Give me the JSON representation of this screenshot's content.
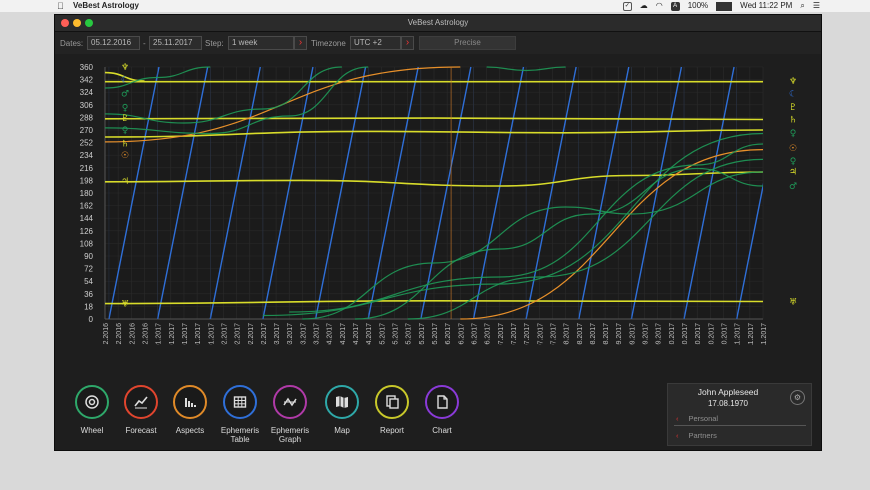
{
  "menubar": {
    "app_name": "VeBest Astrology",
    "battery": "100%",
    "clock": "Wed 11:22 PM"
  },
  "window": {
    "title": "VeBest Astrology",
    "traffic_colors": [
      "#ff5f57",
      "#febc2e",
      "#28c840"
    ]
  },
  "toolbar": {
    "dates_label": "Dates:",
    "date_from": "05.12.2016",
    "date_sep": "-",
    "date_to": "25.11.2017",
    "step_label": "Step:",
    "step_value": "1 week",
    "timezone_label": "Timezone",
    "timezone_value": "UTC +2",
    "precise_label": "Precise",
    "arrow_glyph": "›"
  },
  "chart_data": {
    "type": "line",
    "ylim": [
      0,
      360
    ],
    "y_ticks": [
      0,
      18,
      36,
      54,
      72,
      90,
      108,
      126,
      144,
      162,
      180,
      198,
      216,
      234,
      252,
      270,
      288,
      306,
      324,
      342,
      360
    ],
    "x_ticks": [
      "05.12.2016",
      "12.12.2016",
      "19.12.2016",
      "26.12.2016",
      "02.01.2017",
      "09.01.2017",
      "16.01.2017",
      "23.01.2017",
      "30.01.2017",
      "06.02.2017",
      "13.02.2017",
      "20.02.2017",
      "27.02.2017",
      "06.03.2017",
      "13.03.2017",
      "20.03.2017",
      "27.03.2017",
      "03.04.2017",
      "10.04.2017",
      "17.04.2017",
      "24.04.2017",
      "01.05.2017",
      "08.05.2017",
      "15.05.2017",
      "22.05.2017",
      "29.05.2017",
      "05.06.2017",
      "12.06.2017",
      "19.06.2017",
      "26.06.2017",
      "03.07.2017",
      "10.07.2017",
      "17.07.2017",
      "24.07.2017",
      "31.07.2017",
      "07.08.2017",
      "14.08.2017",
      "21.08.2017",
      "28.08.2017",
      "04.09.2017",
      "11.09.2017",
      "18.09.2017",
      "25.09.2017",
      "02.10.2017",
      "09.10.2017",
      "16.10.2017",
      "23.10.2017",
      "30.10.2017",
      "06.11.2017",
      "13.11.2017",
      "20.11.2017"
    ],
    "colors": {
      "moon": "#2f6fd8",
      "sun": "#e8902a",
      "yellow": "#d8dc2a",
      "green": "#1f9a58",
      "orange_line": "#c8782a"
    },
    "series": [
      {
        "kind": "yellow",
        "points": [
          [
            0,
            339
          ],
          [
            50,
            339
          ]
        ]
      },
      {
        "kind": "yellow",
        "points": [
          [
            0,
            286
          ],
          [
            25,
            287
          ],
          [
            50,
            285
          ]
        ]
      },
      {
        "kind": "yellow",
        "points": [
          [
            0,
            260
          ],
          [
            20,
            268
          ],
          [
            35,
            266
          ],
          [
            50,
            270
          ]
        ]
      },
      {
        "kind": "yellow",
        "points": [
          [
            0,
            196
          ],
          [
            15,
            198
          ],
          [
            30,
            190
          ],
          [
            40,
            205
          ],
          [
            50,
            210
          ]
        ]
      },
      {
        "kind": "yellow",
        "points": [
          [
            0,
            22
          ],
          [
            25,
            26
          ],
          [
            50,
            25
          ]
        ]
      },
      {
        "kind": "yellow",
        "points": [
          [
            0,
            352
          ],
          [
            3,
            340
          ]
        ]
      },
      {
        "kind": "sun",
        "points": [
          [
            0,
            253
          ],
          [
            27,
            360
          ]
        ]
      },
      {
        "kind": "sun",
        "points": [
          [
            27,
            0
          ],
          [
            50,
            242
          ]
        ]
      },
      {
        "kind": "green",
        "points": [
          [
            0,
            330
          ],
          [
            4,
            345
          ],
          [
            8,
            360
          ]
        ]
      },
      {
        "kind": "green",
        "points": [
          [
            0,
            293
          ],
          [
            6,
            280
          ],
          [
            12,
            300
          ],
          [
            18,
            360
          ]
        ]
      },
      {
        "kind": "green",
        "points": [
          [
            0,
            273
          ],
          [
            8,
            265
          ],
          [
            14,
            290
          ],
          [
            20,
            360
          ]
        ]
      },
      {
        "kind": "green",
        "points": [
          [
            29,
            360
          ],
          [
            32,
            355
          ],
          [
            35,
            360
          ]
        ]
      },
      {
        "kind": "green",
        "points": [
          [
            15,
            0
          ],
          [
            25,
            80
          ],
          [
            35,
            160
          ],
          [
            40,
            150
          ],
          [
            50,
            210
          ]
        ]
      },
      {
        "kind": "green",
        "points": [
          [
            19,
            0
          ],
          [
            30,
            100
          ],
          [
            37,
            150
          ],
          [
            45,
            215
          ],
          [
            50,
            190
          ]
        ]
      },
      {
        "kind": "green",
        "points": [
          [
            14,
            10
          ],
          [
            30,
            60
          ],
          [
            45,
            220
          ],
          [
            50,
            250
          ]
        ]
      },
      {
        "kind": "green",
        "points": [
          [
            12,
            5
          ],
          [
            30,
            50
          ],
          [
            50,
            265
          ]
        ]
      },
      {
        "kind": "green",
        "points": [
          [
            23,
            0
          ],
          [
            33,
            60
          ],
          [
            50,
            228
          ]
        ]
      }
    ],
    "moon_cycles_start": [
      0.3,
      4,
      8,
      12,
      16,
      20,
      24,
      28,
      32,
      36,
      40,
      44,
      48
    ],
    "left_symbols": [
      {
        "y": 360,
        "glyph": "♆",
        "kind": "yellow"
      },
      {
        "y": 342,
        "glyph": "☾",
        "kind": "moon"
      },
      {
        "y": 322,
        "glyph": "♂",
        "kind": "green"
      },
      {
        "y": 302,
        "glyph": "♀",
        "kind": "green"
      },
      {
        "y": 287,
        "glyph": "♇",
        "kind": "yellow"
      },
      {
        "y": 270,
        "glyph": "♀",
        "kind": "green"
      },
      {
        "y": 251,
        "glyph": "♄",
        "kind": "yellow"
      },
      {
        "y": 234,
        "glyph": "☉",
        "kind": "sun"
      },
      {
        "y": 197,
        "glyph": "♃",
        "kind": "yellow"
      },
      {
        "y": 22,
        "glyph": "♅",
        "kind": "yellow"
      }
    ],
    "right_symbols": [
      {
        "y": 340,
        "glyph": "♆",
        "kind": "yellow"
      },
      {
        "y": 322,
        "glyph": "☾",
        "kind": "moon"
      },
      {
        "y": 303,
        "glyph": "♇",
        "kind": "yellow"
      },
      {
        "y": 285,
        "glyph": "♄",
        "kind": "yellow"
      },
      {
        "y": 266,
        "glyph": "♀",
        "kind": "green"
      },
      {
        "y": 244,
        "glyph": "☉",
        "kind": "sun"
      },
      {
        "y": 226,
        "glyph": "♀",
        "kind": "green"
      },
      {
        "y": 211,
        "glyph": "♃",
        "kind": "yellow"
      },
      {
        "y": 190,
        "glyph": "♂",
        "kind": "green"
      },
      {
        "y": 25,
        "glyph": "♅",
        "kind": "yellow"
      }
    ]
  },
  "nav": [
    {
      "id": "wheel",
      "label": "Wheel",
      "color": "#2ea86a",
      "icon": "wheel-icon"
    },
    {
      "id": "forecast",
      "label": "Forecast",
      "color": "#e0452e",
      "icon": "forecast-icon"
    },
    {
      "id": "aspects",
      "label": "Aspects",
      "color": "#e08a28",
      "icon": "aspects-icon"
    },
    {
      "id": "ephemeris-table",
      "label": "Ephemeris\nTable",
      "color": "#2f6fd8",
      "icon": "table-icon"
    },
    {
      "id": "ephemeris-graph",
      "label": "Ephemeris\nGraph",
      "color": "#b03aa8",
      "icon": "graph-icon"
    },
    {
      "id": "map",
      "label": "Map",
      "color": "#2ea8a8",
      "icon": "map-icon"
    },
    {
      "id": "report",
      "label": "Report",
      "color": "#c8c82a",
      "icon": "report-icon"
    },
    {
      "id": "chart",
      "label": "Chart",
      "color": "#8a3ad8",
      "icon": "document-icon"
    }
  ],
  "profile": {
    "name": "John Appleseed",
    "date": "17.08.1970",
    "personal_label": "Personal",
    "partners_label": "Partners",
    "chevron": "‹",
    "gear_glyph": "⚙"
  }
}
